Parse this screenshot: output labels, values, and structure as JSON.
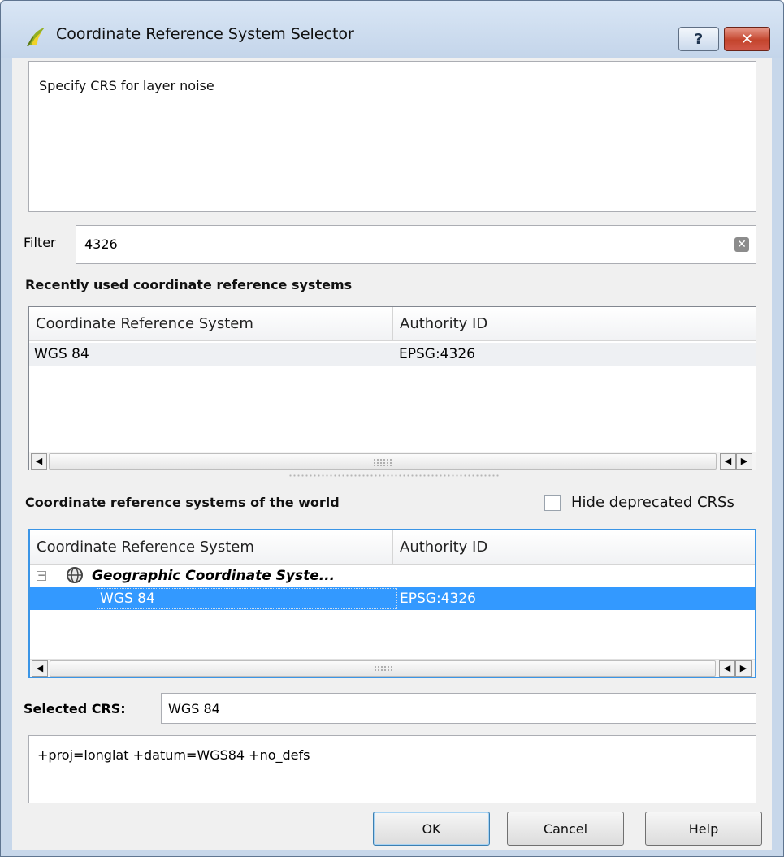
{
  "window": {
    "title": "Coordinate Reference System Selector",
    "help_glyph": "?",
    "close_glyph": "✕"
  },
  "message": "Specify CRS for layer noise",
  "filter": {
    "label": "Filter",
    "value": "4326",
    "clear_glyph": "✕"
  },
  "recent": {
    "heading": "Recently used coordinate reference systems",
    "columns": [
      "Coordinate Reference System",
      "Authority ID"
    ],
    "rows": [
      {
        "crs": "WGS 84",
        "authority": "EPSG:4326"
      }
    ]
  },
  "world": {
    "heading": "Coordinate reference systems of the world",
    "hide_deprecated_label": "Hide deprecated CRSs",
    "hide_deprecated_checked": false,
    "columns": [
      "Coordinate Reference System",
      "Authority ID"
    ],
    "group": {
      "expander": "−",
      "label": "Geographic Coordinate Syste..."
    },
    "rows": [
      {
        "crs": "WGS 84",
        "authority": "EPSG:4326",
        "selected": true
      }
    ]
  },
  "selected_crs": {
    "label": "Selected CRS:",
    "value": "WGS 84"
  },
  "proj_string": "+proj=longlat +datum=WGS84 +no_defs",
  "buttons": {
    "ok": "OK",
    "cancel": "Cancel",
    "help": "Help"
  },
  "scroll": {
    "left_glyph": "◀",
    "right_glyph": "▶"
  },
  "colors": {
    "selection": "#3399ff",
    "focus_border": "#3b95e6",
    "title_bar": "#c4d5ea"
  }
}
